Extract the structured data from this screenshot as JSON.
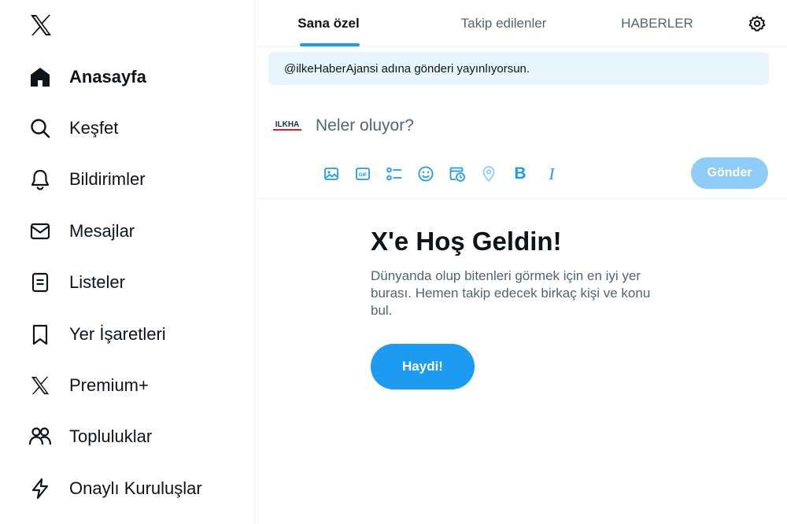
{
  "sidebar": {
    "logo_icon": "x-logo-icon",
    "items": [
      {
        "label": "Anasayfa",
        "icon": "home-icon",
        "active": true
      },
      {
        "label": "Keşfet",
        "icon": "search-icon"
      },
      {
        "label": "Bildirimler",
        "icon": "bell-icon"
      },
      {
        "label": "Mesajlar",
        "icon": "envelope-icon"
      },
      {
        "label": "Listeler",
        "icon": "list-icon"
      },
      {
        "label": "Yer İşaretleri",
        "icon": "bookmark-icon"
      },
      {
        "label": "Premium+",
        "icon": "x-logo-icon"
      },
      {
        "label": "Topluluklar",
        "icon": "people-icon"
      },
      {
        "label": "Onaylı Kuruluşlar",
        "icon": "lightning-icon"
      }
    ]
  },
  "tabs": [
    {
      "label": "Sana özel",
      "active": true
    },
    {
      "label": "Takip edilenler"
    },
    {
      "label": "HABERLER"
    }
  ],
  "settings_icon": "gear-icon",
  "notice": "@ilkeHaberAjansi adına gönderi yayınlıyorsun.",
  "composer": {
    "avatar_text": "ILKHA",
    "placeholder": "Neler oluyor?",
    "tools": [
      "image-icon",
      "gif-icon",
      "poll-icon",
      "emoji-icon",
      "schedule-icon",
      "location-icon",
      "bold-icon",
      "italic-icon"
    ],
    "bold_label": "B",
    "italic_label": "I",
    "post_label": "Gönder"
  },
  "welcome": {
    "title": "X'e Hoş Geldin!",
    "text": "Dünyanda olup bitenleri görmek için en iyi yer burası. Hemen takip edecek birkaç kişi ve konu bul.",
    "button": "Haydi!"
  },
  "colors": {
    "accent": "#1d9bf0",
    "accent_disabled": "#8ecdf8",
    "notice_bg": "#e8f5fd",
    "text": "#0f1419",
    "muted": "#536471"
  }
}
